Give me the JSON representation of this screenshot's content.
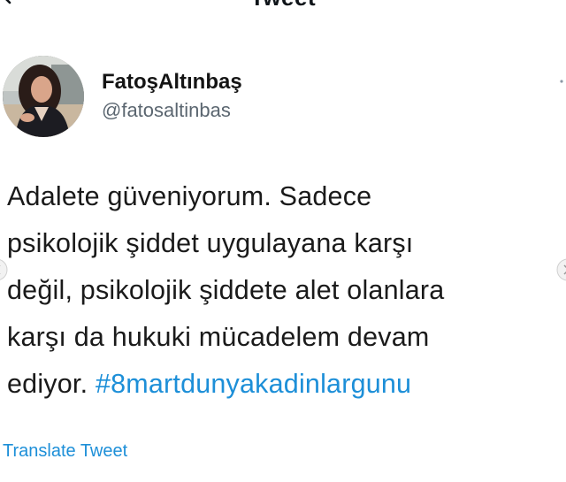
{
  "header": {
    "title": "Tweet",
    "back_icon": "arrow-left-icon"
  },
  "author": {
    "display_name": "FatoşAltınbaş",
    "handle": "@fatosaltinbas",
    "avatar": "profile-photo"
  },
  "tweet": {
    "lines": [
      "Adalete güveniyorum. Sadece",
      "psikolojik şiddet uygulayana karşı",
      "değil, psikolojik şiddete alet olanlara",
      "karşı da hukuki mücadelem devam"
    ],
    "last_line_text": "ediyor. ",
    "hashtag": "#8martdunyakadinlargunu"
  },
  "actions": {
    "translate_label": "Translate Tweet",
    "more_icon": "more-options-icon"
  },
  "colors": {
    "link": "#1d8fd8",
    "text": "#1a1a1a",
    "secondary": "#5b6670"
  }
}
